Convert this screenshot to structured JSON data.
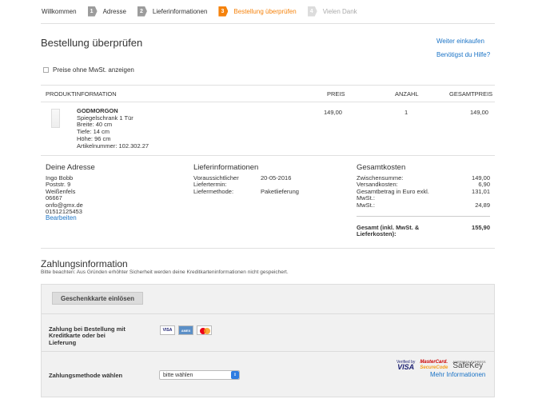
{
  "steps": [
    {
      "num": "",
      "label": "Willkommen",
      "state": "done"
    },
    {
      "num": "1",
      "label": "Adresse",
      "state": "done"
    },
    {
      "num": "2",
      "label": "Lieferinformationen",
      "state": "done"
    },
    {
      "num": "3",
      "label": "Bestellung überprüfen",
      "state": "active"
    },
    {
      "num": "4",
      "label": "Vielen Dank",
      "state": "inactive"
    }
  ],
  "header": {
    "title": "Bestellung überprüfen",
    "continue_link": "Weiter einkaufen",
    "help_link": "Benötigst du Hilfe?"
  },
  "prices_checkbox": {
    "label": "Preise ohne MwSt. anzeigen",
    "checked": false
  },
  "table": {
    "headers": {
      "product": "PRODUKTINFORMATION",
      "price": "PREIS",
      "qty": "ANZAHL",
      "total": "GESAMTPREIS"
    },
    "row": {
      "name": "GODMORGON",
      "desc": "Spiegelschrank 1 Tür",
      "width": "Breite: 40 cm",
      "depth": "Tiefe: 14 cm",
      "height": "Höhe: 96 cm",
      "article": "Artikelnummer: 102.302.27",
      "price": "149,00",
      "qty": "1",
      "total": "149,00"
    }
  },
  "address": {
    "heading": "Deine Adresse",
    "lines": [
      "Ingo Bobb",
      "Poststr. 9",
      "Weißenfels",
      "06667",
      "onfo@gmx.de",
      "01512125453"
    ],
    "edit_link": "Bearbeiten"
  },
  "delivery": {
    "heading": "Lieferinformationen",
    "date_label1": "Voraussichtlicher",
    "date_label2": "Liefertermin:",
    "date_value": "20-05-2016",
    "method_label": "Liefermethode:",
    "method_value": "Paketlieferung"
  },
  "costs": {
    "heading": "Gesamtkosten",
    "subtotal_label": "Zwischensumme:",
    "subtotal_value": "149,00",
    "shipping_label": "Versandkosten:",
    "shipping_value": "6,90",
    "net_label1": "Gesamtbetrag in Euro exkl.",
    "net_label2": "MwSt.:",
    "net_value": "131,01",
    "vat_label": "MwSt.:",
    "vat_value": "24,89",
    "total_label1": "Gesamt (inkl. MwSt. &",
    "total_label2": "Lieferkosten):",
    "total_value": "155,90"
  },
  "payment": {
    "title": "Zahlungsinformation",
    "note": "Bitte beachten: Aus Gründen erhöhter Sicherheit werden deine Kreditkarteninformationen nicht gespeichert.",
    "gift_button": "Geschenkkarte einlösen",
    "card_label1": "Zahlung bei Bestellung mit",
    "card_label2": "Kreditkarte oder bei",
    "card_label3": "Lieferung",
    "cards": {
      "visa": "VISA",
      "amex": "AMEX"
    },
    "method_label": "Zahlungsmethode wählen",
    "select_value": "bitte wählen",
    "vbv_top": "Verified by",
    "vbv_brand": "VISA",
    "msc_top": "MasterCard.",
    "msc_bottom": "SecureCode",
    "sk_top": "AMERICAN EXPRESS",
    "sk_brand": "SafeKey",
    "more_info": "Mehr Informationen"
  }
}
